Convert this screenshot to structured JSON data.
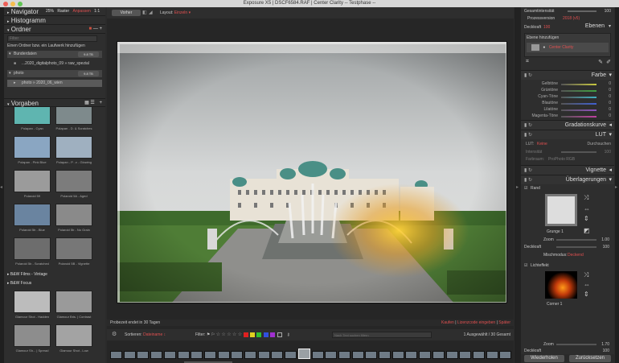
{
  "window": {
    "title": "Exposure X5 | DSCF6584.RAF | Center Clarity -- Testphase --"
  },
  "navigator": {
    "label": "Navigator",
    "zoom": "25%",
    "fit": "Raster",
    "fill": "Anpassen",
    "one": "1:1"
  },
  "histogram": {
    "label": "Histogramm"
  },
  "folders": {
    "label": "Ordner",
    "filter_placeholder": "Filter",
    "hint": "Einen Ordner bzw. ein Laufwerk hinzufügen",
    "items": [
      {
        "name": "Bunderdaten",
        "size": "9.8 TB"
      },
      {
        "name": "...2020_digitalphoto_09 » raw_spezial",
        "size": ""
      },
      {
        "name": "photo",
        "size": "9.8 TB"
      },
      {
        "name": "photo » 2020_06_wien",
        "size": ""
      }
    ]
  },
  "presets": {
    "label": "Vorgaben",
    "items": [
      {
        "name": "Polapan - Cyan",
        "color": "#5fb5b0"
      },
      {
        "name": "Polapan - D. & Scratches",
        "color": "#7e8a8c"
      },
      {
        "name": "Polapan - Pink Blue",
        "color": "#8aa6c2"
      },
      {
        "name": "Polapan - P. -v - Glowing",
        "color": "#9fb0c0"
      },
      {
        "name": "Polaroid 59",
        "color": "#9b9b9b"
      },
      {
        "name": "Polaroid 5A - Aged",
        "color": "#7c7c7c"
      },
      {
        "name": "Polaroid 5b - Blue",
        "color": "#6a84a0"
      },
      {
        "name": "Polaroid 5b - No Grain",
        "color": "#8a8a8a"
      },
      {
        "name": "Polaroid 5b - Scratched",
        "color": "#6d6d6d"
      },
      {
        "name": "Polaroid 5B - Vignette",
        "color": "#777777"
      }
    ],
    "groups": [
      "B&W Films - Vintage",
      "B&W Focus"
    ],
    "items2": [
      {
        "name": "Glamour Shot - Hadden",
        "color": "#bcbcbc"
      },
      {
        "name": "Glamour Bris. | Contrast",
        "color": "#9a9a9a"
      },
      {
        "name": "Glamour Sh... | Spread",
        "color": "#8d8d8d"
      },
      {
        "name": "Glamour Shot - Low",
        "color": "#a3a3a3"
      }
    ]
  },
  "toolbar": {
    "before_label": "Vorher",
    "layout_label": "Layout:",
    "layout_value": "Einzeln"
  },
  "status": {
    "trial": "Probezeit endet in 30 Tagen",
    "buy": "Kaufen",
    "license": "Lizenzcode eingeben",
    "later": "Später"
  },
  "filterbar": {
    "sort_label": "Sortieren:",
    "sort_value": "Dateiname",
    "filter_label": "Filter:",
    "search_placeholder": "Nach Text suchen filtern",
    "count": "1 Ausgewählt / 30 Gesamt"
  },
  "layers_top": {
    "total_label": "Gesamtintensität",
    "total_value": "100",
    "process_label": "Prozessversion",
    "process_value": "2018 (v5)",
    "opacity_label": "Deckkraft",
    "opacity_value": "100",
    "layers_label": "Ebenen",
    "add_layer": "Ebene hinzufügen",
    "layer_name": "Center Clarity"
  },
  "color_panel": {
    "title": "Farbe",
    "rows": [
      {
        "label": "Gelbtöne",
        "value": "0",
        "color": "#c8c840"
      },
      {
        "label": "Grüntöne",
        "value": "0",
        "color": "#40a040"
      },
      {
        "label": "Cyan-Töne",
        "value": "0",
        "color": "#40b0c0"
      },
      {
        "label": "Blautöne",
        "value": "0",
        "color": "#4060d0"
      },
      {
        "label": "Lilatöne",
        "value": "0",
        "color": "#9050c0"
      },
      {
        "label": "Magenta-Töne",
        "value": "0",
        "color": "#c040a0"
      }
    ]
  },
  "gradation": {
    "title": "Gradationskurve"
  },
  "lut": {
    "title": "LUT",
    "lut_label": "LUT:",
    "lut_value": "Keine",
    "browse": "Durchsuchen",
    "intensity_label": "Intensität",
    "intensity_value": "100",
    "color_space_label": "Farbraum:",
    "color_space_value": "ProPhoto RGB"
  },
  "vignette": {
    "title": "Vignette"
  },
  "overlays": {
    "title": "Überlagerungen",
    "border_label": "Rand",
    "border_name": "Grunge 1",
    "zoom_label": "Zoom",
    "zoom_value": "1.00",
    "opacity_label": "Deckkraft",
    "opacity_value": "100",
    "blend_label": "Mischmodus:",
    "blend_value": "Deckend",
    "light_label": "Lichteffekt",
    "light_name": "Corner 1",
    "light_zoom_value": "1.70",
    "light_opacity_value": "100"
  },
  "bottom": {
    "redo": "Wiederholen",
    "reset": "Zurücksetzen"
  }
}
